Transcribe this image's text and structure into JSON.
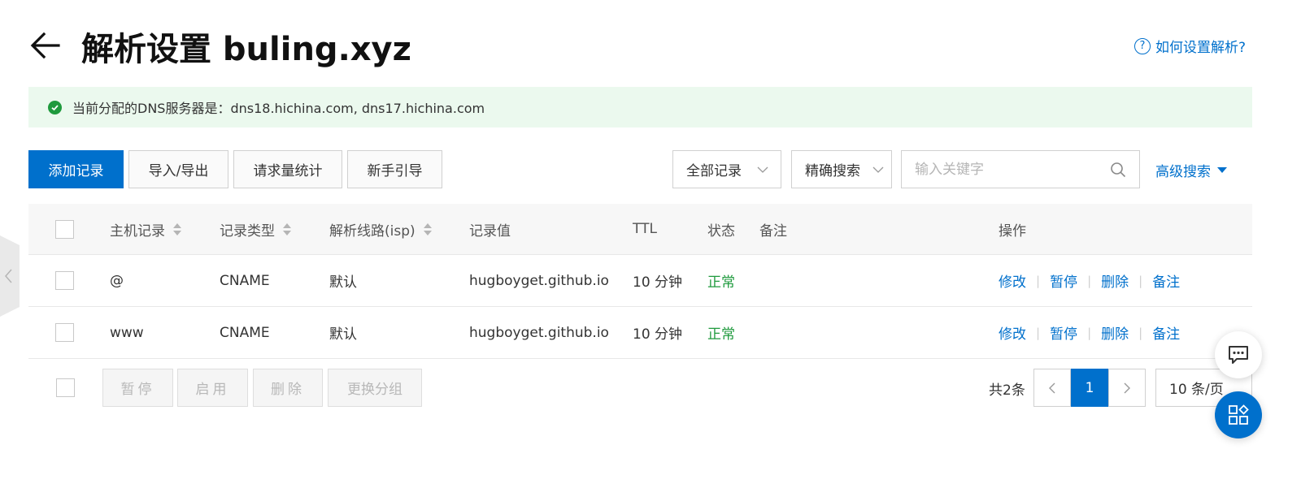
{
  "header": {
    "title": "解析设置 buling.xyz",
    "help_icon_text": "?",
    "help_link": "如何设置解析?"
  },
  "banner": {
    "text": "当前分配的DNS服务器是：dns18.hichina.com, dns17.hichina.com"
  },
  "toolbar": {
    "add_record": "添加记录",
    "import_export": "导入/导出",
    "request_stats": "请求量统计",
    "beginner_guide": "新手引导",
    "record_filter": "全部记录",
    "search_mode": "精确搜索",
    "search_placeholder": "输入关键字",
    "advanced_search": "高级搜索"
  },
  "table": {
    "columns": {
      "host": "主机记录",
      "type": "记录类型",
      "line": "解析线路(isp)",
      "value": "记录值",
      "ttl": "TTL",
      "status": "状态",
      "remark": "备注",
      "ops": "操作"
    },
    "rows": [
      {
        "host": "@",
        "type": "CNAME",
        "line": "默认",
        "value": "hugboyget.github.io",
        "ttl": "10 分钟",
        "status": "正常",
        "remark": ""
      },
      {
        "host": "www",
        "type": "CNAME",
        "line": "默认",
        "value": "hugboyget.github.io",
        "ttl": "10 分钟",
        "status": "正常",
        "remark": ""
      }
    ],
    "row_ops": {
      "edit": "修改",
      "pause": "暂停",
      "delete": "删除",
      "note": "备注",
      "sep": "|"
    }
  },
  "batch": {
    "pause": "暂停",
    "enable": "启用",
    "delete": "删除",
    "change_group": "更换分组"
  },
  "pagination": {
    "total": "共2条",
    "current_page": "1",
    "page_size": "10 条/页"
  },
  "colors": {
    "primary": "#0070cc",
    "success": "#1f9a3d",
    "banner_bg": "#ebf9ee"
  }
}
